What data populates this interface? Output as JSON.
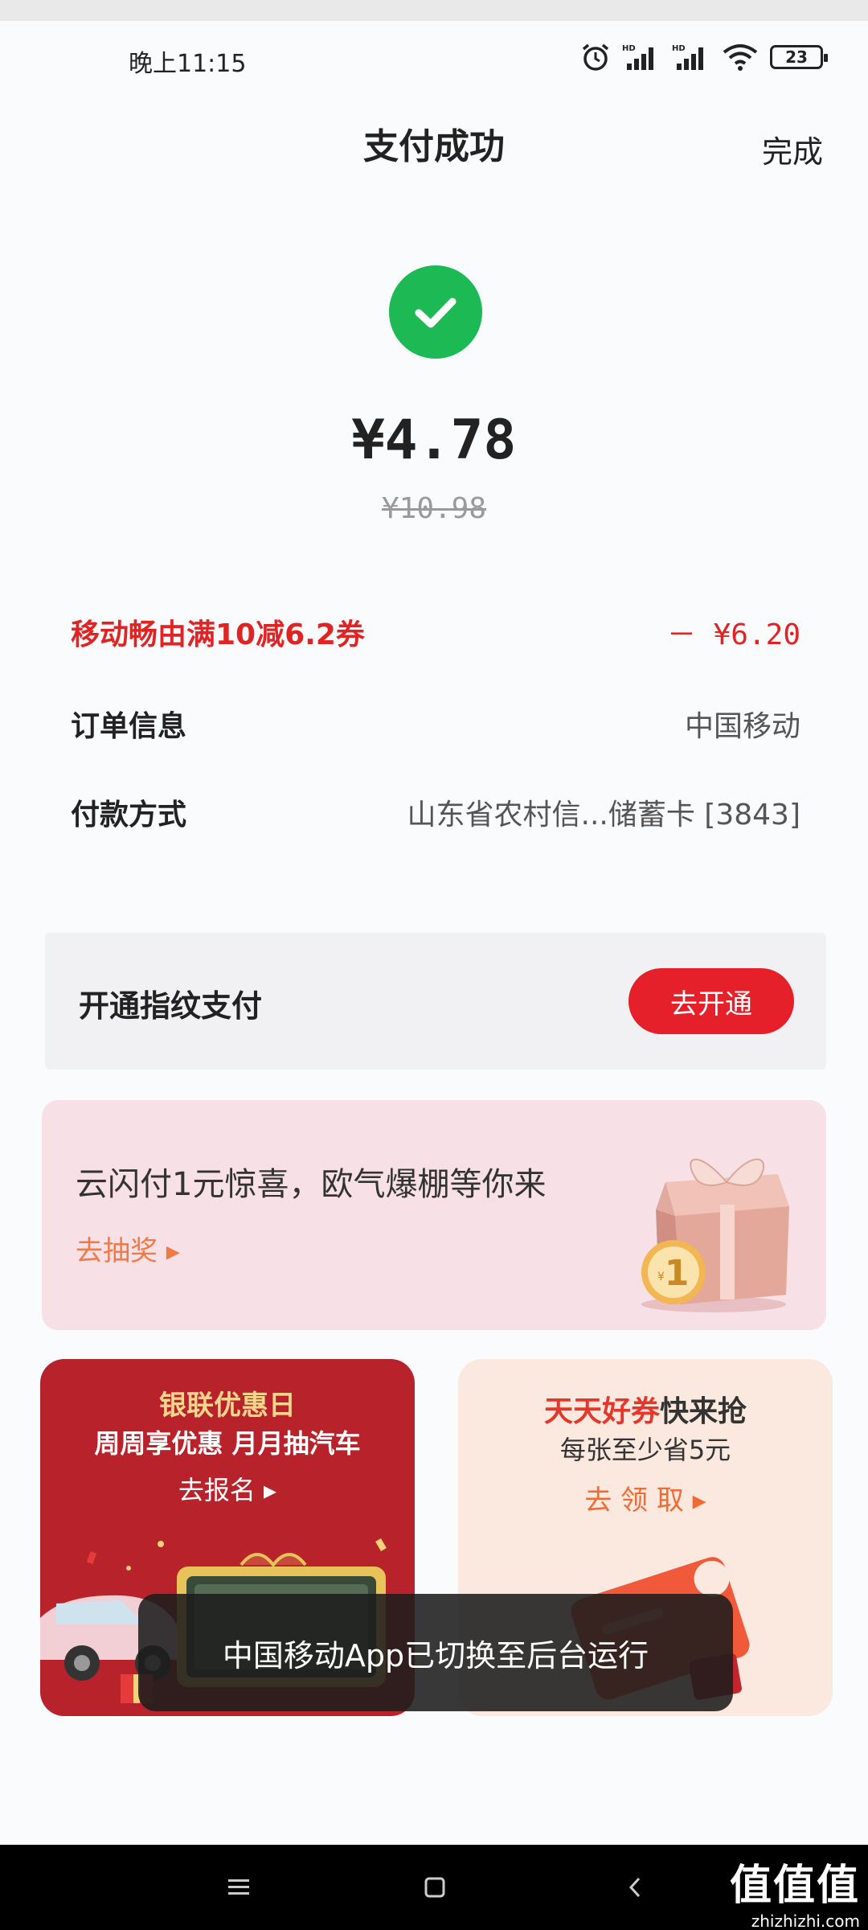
{
  "status": {
    "time": "晚上11:15",
    "battery": "23",
    "signal_label": "HD"
  },
  "header": {
    "title": "支付成功",
    "done_label": "完成"
  },
  "payment": {
    "amount": "¥4.78",
    "original_amount": "¥10.98"
  },
  "details": {
    "coupon_label": "移动畅由满10减6.2券",
    "coupon_value": "－ ¥6.20",
    "order_label": "订单信息",
    "order_value": "中国移动",
    "method_label": "付款方式",
    "method_value": "山东省农村信...储蓄卡 [3843]"
  },
  "fingerprint": {
    "label": "开通指纹支付",
    "button": "去开通"
  },
  "promo": {
    "title": "云闪付1元惊喜，欧气爆棚等你来",
    "link": "去抽奖 ▸",
    "coin_label": "1"
  },
  "card_left": {
    "title": "银联优惠日",
    "subtitle": "周周享优惠 月月抽汽车",
    "link": "去报名 ▸"
  },
  "card_right": {
    "title_highlight": "天天好券",
    "title_rest": "快来抢",
    "subtitle": "每张至少省5元",
    "link": "去 领 取 ▸"
  },
  "toast": {
    "text": "中国移动App已切换至后台运行"
  },
  "watermark": {
    "big": "值值值",
    "small": "zhizhizhi.com"
  },
  "colors": {
    "success": "#1db954",
    "accent_red": "#e6202a",
    "coupon_red": "#e02424",
    "promo_orange": "#f07a45"
  }
}
